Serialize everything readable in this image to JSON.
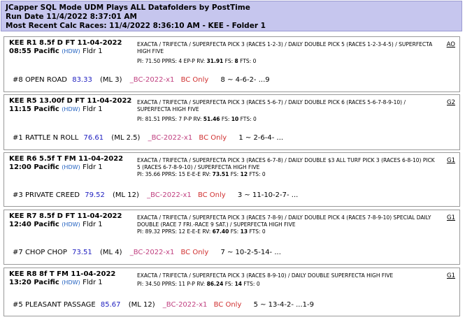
{
  "header": {
    "line1": "JCapper SQL Mode UDM Plays ALL Datafolders by PostTime",
    "line2": "Run Date 11/4/2022 8:37:01 AM",
    "line3": "Most Recent Calc Races: 11/4/2022 8:36:10 AM - KEE - Folder 1"
  },
  "races": [
    {
      "title": "KEE R1 8.5f D FT 11-04-2022",
      "time": "08:55 Pacific",
      "hdw": "(HDW)",
      "fldr": "Fldr 1",
      "wagers": "EXACTA / TRIFECTA / SUPERFECTA PICK 3 (RACES 1-2-3) / DAILY DOUBLE PICK 5 (RACES 1-2-3-4-5) / SUPERFECTA HIGH FIVE",
      "stats_prefix": "PI: 71.50  PPRS: 4  EP-P  RV:",
      "rv": "31.91",
      "fs_label": "FS:",
      "fs": "8",
      "fts": "FTS: 0",
      "link": "AO",
      "pick_num": "#8",
      "pick_name": "OPEN ROAD",
      "score": "83.33",
      "ml": "(ML 3)",
      "bc": "_BC-2022-x1",
      "bconly": "BC Only",
      "seq": "8 ~ 4-6-2- ...9"
    },
    {
      "title": "KEE R5 13.00f D FT 11-04-2022",
      "time": "11:15 Pacific",
      "hdw": "(HDW)",
      "fldr": "Fldr 1",
      "wagers": "EXACTA / TRIFECTA / SUPERFECTA PICK 3 (RACES 5-6-7) / DAILY DOUBLE PICK 6 (RACES 5-6-7-8-9-10) / SUPERFECTA HIGH FIVE",
      "stats_prefix": "PI: 81.51  PPRS: 7  P-P  RV:",
      "rv": "51.46",
      "fs_label": "FS:",
      "fs": "10",
      "fts": "FTS: 0",
      "link": "G2",
      "pick_num": "#1",
      "pick_name": "RATTLE N ROLL",
      "score": "76.61",
      "ml": "(ML 2.5)",
      "bc": "_BC-2022-x1",
      "bconly": "BC Only",
      "seq": "1 ~ 2-6-4- ..."
    },
    {
      "title": "KEE R6 5.5f T FM 11-04-2022",
      "time": "12:00 Pacific",
      "hdw": "(HDW)",
      "fldr": "Fldr 1",
      "wagers": "EXACTA / TRIFECTA / SUPERFECTA PICK 3 (RACES 6-7-8) / DAILY DOUBLE $3 ALL TURF PICK 3 (RACES 6-8-10) PICK 5 (RACES 6-7-8-9-10) / SUPERFECTA HIGH FIVE",
      "stats_prefix": "PI: 35.66  PPRS: 15  E-E-E  RV:",
      "rv": "73.51",
      "fs_label": "FS:",
      "fs": "12",
      "fts": "FTS: 0",
      "link": "G1",
      "pick_num": "#3",
      "pick_name": "PRIVATE CREED",
      "score": "79.52",
      "ml": "(ML 12)",
      "bc": "_BC-2022-x1",
      "bconly": "BC Only",
      "seq": "3 ~ 11-10-2-7- ..."
    },
    {
      "title": "KEE R7 8.5f D FT 11-04-2022",
      "time": "12:40 Pacific",
      "hdw": "(HDW)",
      "fldr": "Fldr 1",
      "wagers": "EXACTA / TRIFECTA / SUPERFECTA PICK 3 (RACES 7-8-9) / DAILY DOUBLE PICK 4 (RACES 7-8-9-10) SPECIAL DAILY DOUBLE (RACE 7 FRI.-RACE 9 SAT.) / SUPERFECTA HIGH FIVE",
      "stats_prefix": "PI: 89.32  PPRS: 12  E-E-E  RV:",
      "rv": "67.40",
      "fs_label": "FS:",
      "fs": "13",
      "fts": "FTS: 0",
      "link": "G1",
      "pick_num": "#7",
      "pick_name": "CHOP CHOP",
      "score": "73.51",
      "ml": "(ML 4)",
      "bc": "_BC-2022-x1",
      "bconly": "BC Only",
      "seq": "7 ~ 10-2-5-14- ..."
    },
    {
      "title": "KEE R8 8f T FM 11-04-2022",
      "time": "13:20 Pacific",
      "hdw": "(HDW)",
      "fldr": "Fldr 1",
      "wagers": "EXACTA / TRIFECTA / SUPERFECTA PICK 3 (RACES 8-9-10) / DAILY DOUBLE SUPERFECTA HIGH FIVE",
      "stats_prefix": "PI: 34.50  PPRS: 11  P-P  RV:",
      "rv": "86.24",
      "fs_label": "FS:",
      "fs": "14",
      "fts": "FTS: 0",
      "link": "G1",
      "pick_num": "#5",
      "pick_name": "PLEASANT PASSAGE",
      "score": "85.67",
      "ml": "(ML 12)",
      "bc": "_BC-2022-x1",
      "bconly": "BC Only",
      "seq": "5 ~ 13-4-2- ...1-9"
    }
  ]
}
